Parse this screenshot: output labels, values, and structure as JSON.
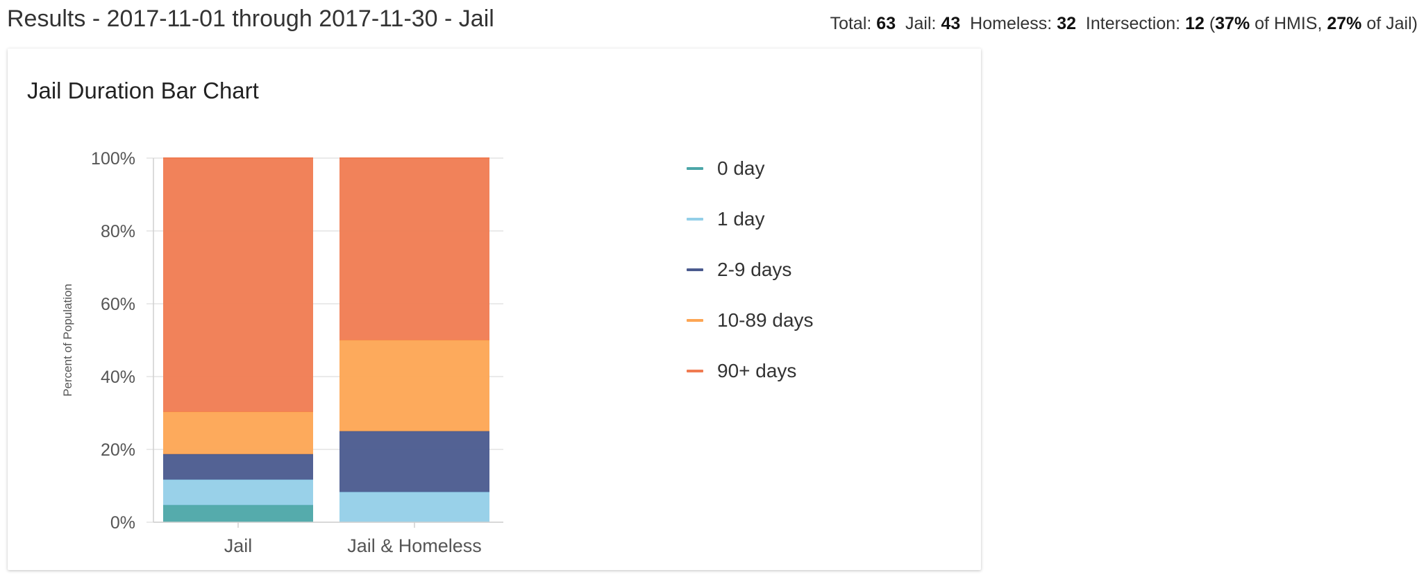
{
  "header": {
    "title": "Results - 2017-11-01 through 2017-11-30 - Jail",
    "stats": {
      "total_label": "Total:",
      "total_value": "63",
      "jail_label": "Jail:",
      "jail_value": "43",
      "homeless_label": "Homeless:",
      "homeless_value": "32",
      "intersection_label": "Intersection:",
      "intersection_value": "12",
      "open_paren": "(",
      "hmis_pct": "37%",
      "hmis_text": "of HMIS,",
      "jail_pct": "27%",
      "jail_text": "of Jail)"
    }
  },
  "card": {
    "title": "Jail Duration Bar Chart"
  },
  "chart_data": {
    "type": "bar",
    "stacked": true,
    "title": "Jail Duration Bar Chart",
    "xlabel": "",
    "ylabel": "Percent of Population",
    "ylim": [
      0,
      100
    ],
    "yticks": [
      "0%",
      "20%",
      "40%",
      "60%",
      "80%",
      "100%"
    ],
    "categories": [
      "Jail",
      "Jail & Homeless"
    ],
    "series": [
      {
        "name": "0 day",
        "color": "#4ca6a8",
        "values": [
          4.7,
          0
        ]
      },
      {
        "name": "1 day",
        "color": "#93cfe8",
        "values": [
          7.0,
          8.3
        ]
      },
      {
        "name": "2-9 days",
        "color": "#4a5a8e",
        "values": [
          7.0,
          16.7
        ]
      },
      {
        "name": "10-89 days",
        "color": "#fda553",
        "values": [
          11.6,
          25.0
        ]
      },
      {
        "name": "90+ days",
        "color": "#f07b51",
        "values": [
          69.7,
          50.0
        ]
      }
    ],
    "grid": true,
    "legend_position": "right"
  }
}
